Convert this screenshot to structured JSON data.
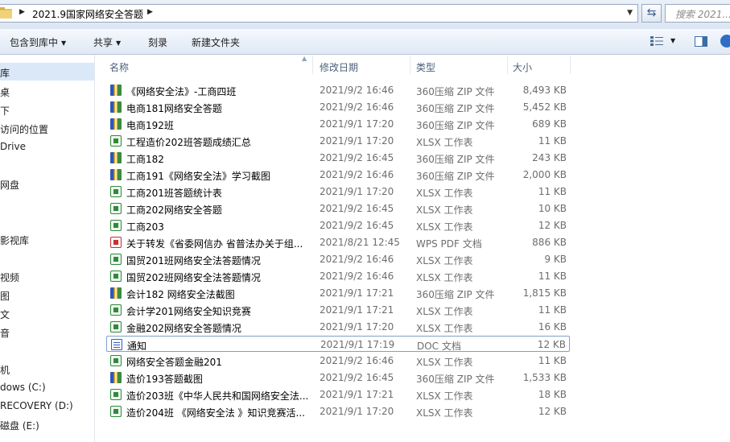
{
  "address": {
    "path": "2021.9国家网络安全答题",
    "search_placeholder": "搜索 2021...."
  },
  "toolbar": {
    "include_library": "包含到库中",
    "share": "共享",
    "burn": "刻录",
    "new_folder": "新建文件夹"
  },
  "nav": {
    "items": [
      "库",
      "桌",
      "下",
      "访问的位置",
      "Drive",
      "网盘",
      "影视库",
      "视频",
      "图",
      "文",
      "音",
      "机",
      "dows  (C:)",
      "RECOVERY (D:)",
      "磁盘 (E:)"
    ]
  },
  "columns": {
    "name": "名称",
    "date": "修改日期",
    "type": "类型",
    "size": "大小"
  },
  "files": [
    {
      "name": "《网络安全法》-工商四班",
      "date": "2021/9/2 16:46",
      "type": "360压缩 ZIP 文件",
      "size": "8,493 KB",
      "icon": "zip-icon"
    },
    {
      "name": "电商181网络安全答题",
      "date": "2021/9/2 16:46",
      "type": "360压缩 ZIP 文件",
      "size": "5,452 KB",
      "icon": "zip-icon"
    },
    {
      "name": "电商192班",
      "date": "2021/9/1 17:20",
      "type": "360压缩 ZIP 文件",
      "size": "689 KB",
      "icon": "zip-icon"
    },
    {
      "name": "工程造价202班答题成绩汇总",
      "date": "2021/9/1 17:20",
      "type": "XLSX 工作表",
      "size": "11 KB",
      "icon": "xlsx-icon"
    },
    {
      "name": "工商182",
      "date": "2021/9/2 16:45",
      "type": "360压缩 ZIP 文件",
      "size": "243 KB",
      "icon": "zip-icon"
    },
    {
      "name": "工商191《网络安全法》学习截图",
      "date": "2021/9/2 16:46",
      "type": "360压缩 ZIP 文件",
      "size": "2,000 KB",
      "icon": "zip-icon"
    },
    {
      "name": "工商201班答题统计表",
      "date": "2021/9/1 17:20",
      "type": "XLSX 工作表",
      "size": "11 KB",
      "icon": "xlsx-icon"
    },
    {
      "name": "工商202网络安全答题",
      "date": "2021/9/2 16:45",
      "type": "XLSX 工作表",
      "size": "10 KB",
      "icon": "xlsx-icon"
    },
    {
      "name": "工商203",
      "date": "2021/9/2 16:45",
      "type": "XLSX 工作表",
      "size": "12 KB",
      "icon": "xlsx-icon"
    },
    {
      "name": "关于转发《省委网信办 省普法办关于组...",
      "date": "2021/8/21 12:45",
      "type": "WPS PDF 文档",
      "size": "886 KB",
      "icon": "pdf-icon"
    },
    {
      "name": "国贸201班网络安全法答题情况",
      "date": "2021/9/2 16:46",
      "type": "XLSX 工作表",
      "size": "9 KB",
      "icon": "xlsx-icon"
    },
    {
      "name": "国贸202班网络安全法答题情况",
      "date": "2021/9/2 16:46",
      "type": "XLSX 工作表",
      "size": "11 KB",
      "icon": "xlsx-icon"
    },
    {
      "name": "会计182 网络安全法截图",
      "date": "2021/9/1 17:21",
      "type": "360压缩 ZIP 文件",
      "size": "1,815 KB",
      "icon": "zip-icon"
    },
    {
      "name": "会计学201网络安全知识竞赛",
      "date": "2021/9/1 17:21",
      "type": "XLSX 工作表",
      "size": "11 KB",
      "icon": "xlsx-icon"
    },
    {
      "name": "金融202网络安全答题情况",
      "date": "2021/9/1 17:20",
      "type": "XLSX 工作表",
      "size": "16 KB",
      "icon": "xlsx-icon"
    },
    {
      "name": "通知",
      "date": "2021/9/1 17:19",
      "type": "DOC 文档",
      "size": "12 KB",
      "icon": "doc-icon"
    },
    {
      "name": "网络安全答题金融201",
      "date": "2021/9/2 16:46",
      "type": "XLSX 工作表",
      "size": "11 KB",
      "icon": "xlsx-icon"
    },
    {
      "name": "造价193答题截图",
      "date": "2021/9/2 16:45",
      "type": "360压缩 ZIP 文件",
      "size": "1,533 KB",
      "icon": "zip-icon"
    },
    {
      "name": "造价203班《中华人民共和国网络安全法...",
      "date": "2021/9/1 17:21",
      "type": "XLSX 工作表",
      "size": "18 KB",
      "icon": "xlsx-icon"
    },
    {
      "name": "造价204班 《网络安全法 》知识竞赛活...",
      "date": "2021/9/1 17:20",
      "type": "XLSX 工作表",
      "size": "12 KB",
      "icon": "xlsx-icon"
    }
  ],
  "focused_row": 15
}
